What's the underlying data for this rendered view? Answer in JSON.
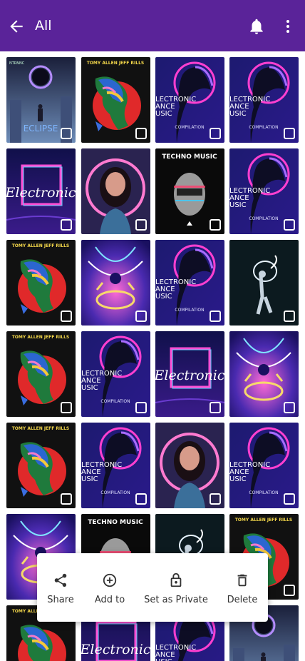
{
  "header": {
    "title": "All",
    "colors": {
      "bar": "#5a2399",
      "icons": "#ffffff"
    }
  },
  "grid": {
    "tiles": [
      {
        "art": "eclipse"
      },
      {
        "art": "tommy"
      },
      {
        "art": "compilation"
      },
      {
        "art": "compilation"
      },
      {
        "art": "electronic"
      },
      {
        "art": "girl"
      },
      {
        "art": "techno"
      },
      {
        "art": "compilation"
      },
      {
        "art": "tommy"
      },
      {
        "art": "kaleido"
      },
      {
        "art": "compilation"
      },
      {
        "art": "dancer"
      },
      {
        "art": "tommy"
      },
      {
        "art": "compilation"
      },
      {
        "art": "electronic"
      },
      {
        "art": "kaleido"
      },
      {
        "art": "tommy"
      },
      {
        "art": "compilation"
      },
      {
        "art": "girl"
      },
      {
        "art": "compilation"
      },
      {
        "art": "kaleido"
      },
      {
        "art": "techno"
      },
      {
        "art": "dancer"
      },
      {
        "art": "tommy"
      },
      {
        "art": "tommy"
      },
      {
        "art": "electronic"
      },
      {
        "art": "compilation"
      },
      {
        "art": "eclipse"
      }
    ],
    "art_text": {
      "eclipse": "ECLIPSE",
      "eclipse_small": "NTRNNC",
      "tommy": "TOMY ALLEN JEFF RILLS",
      "electronic": "Electronic",
      "compilation_lines": [
        "LECTRONIC",
        "ANCE",
        "USIC"
      ],
      "compilation_footer": "COMPILATION",
      "techno": "TECHNO MUSIC"
    }
  },
  "action_sheet": {
    "items": [
      {
        "label": "Share",
        "icon": "share-icon"
      },
      {
        "label": "Add to",
        "icon": "add-circle-icon"
      },
      {
        "label": "Set as Private",
        "icon": "lock-icon"
      },
      {
        "label": "Delete",
        "icon": "trash-icon"
      }
    ]
  }
}
